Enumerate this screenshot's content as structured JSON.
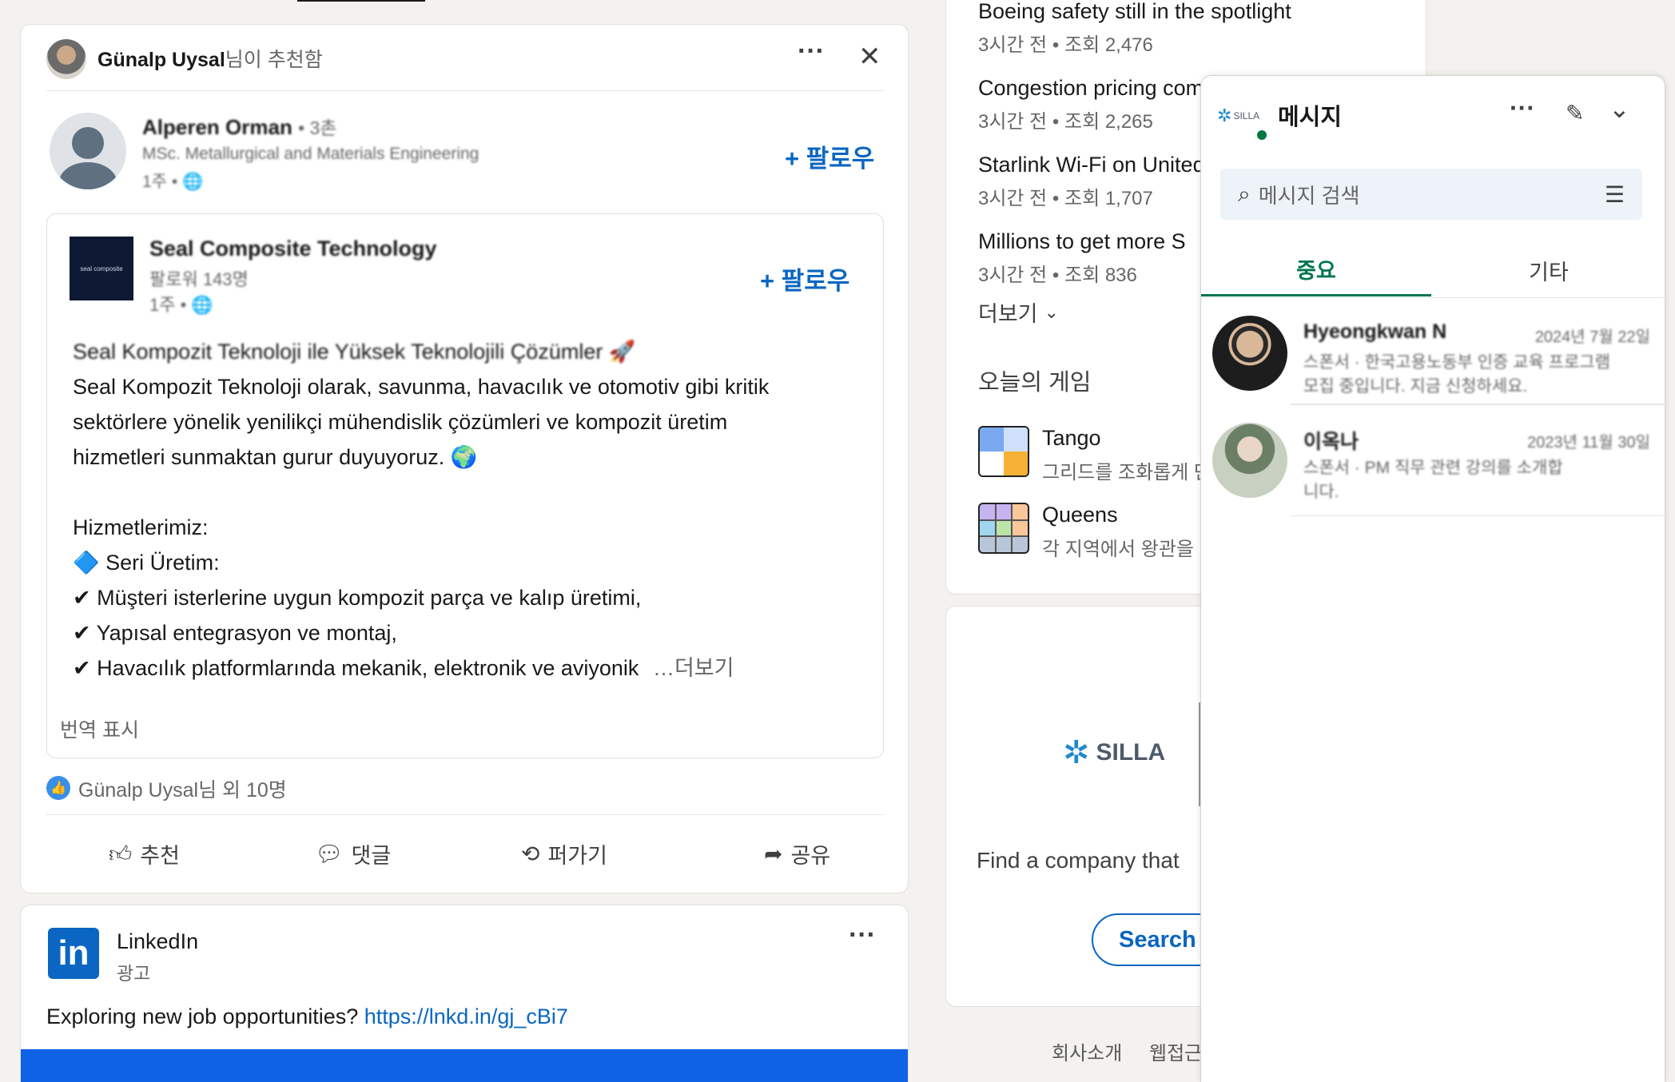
{
  "post": {
    "recommender_name": "Günalp Uysal",
    "recommender_suffix": "님이 추천함",
    "more_label": "···",
    "close_label": "✕",
    "author_name": "Alperen Orman",
    "author_degree": "• 3촌",
    "author_headline": "MSc. Metallurgical and Materials Engineering",
    "author_time": "1주 • 🌐",
    "follow_label": "+ 팔로우",
    "company_name": "Seal Composite Technology",
    "company_followers": "팔로워 143명",
    "company_time": "1주 • 🌐",
    "company_logo_text": "seal composite",
    "company_follow_label": "+ 팔로우",
    "body_lines": [
      "Seal Kompozit Teknoloji ile Yüksek Teknolojili Çözümler 🚀",
      "Seal Kompozit Teknoloji olarak, savunma, havacılık ve otomotiv gibi kritik",
      "sektörlere yönelik yenilikçi mühendislik çözümleri ve kompozit üretim",
      "hizmetleri sunmaktan gurur duyuyoruz. 🌍",
      "",
      "Hizmetlerimiz:",
      "🔷 Seri Üretim:",
      "✔ Müşteri isterlerine uygun kompozit parça ve kalıp üretimi,",
      "✔ Yapısal entegrasyon ve montaj,",
      "✔ Havacılık platformlarında mekanik, elektronik ve aviyonik"
    ],
    "see_more": "…더보기",
    "translate_label": "번역 표시",
    "reactions_text": "Günalp Uysal님 외 10명",
    "actions": {
      "like": "추천",
      "comment": "댓글",
      "repost": "퍼가기",
      "share": "공유"
    }
  },
  "ad": {
    "name": "LinkedIn",
    "sub": "광고",
    "more_label": "···",
    "text": "Exploring new job opportunities? ",
    "link": "https://lnkd.in/gj_cBi7"
  },
  "news": {
    "items": [
      {
        "title": "Boeing safety still in the spotlight",
        "meta": "3시간 전 • 조회 2,476"
      },
      {
        "title": "Congestion pricing comes to NYC",
        "meta": "3시간 전 • 조회 2,265"
      },
      {
        "title": "Starlink Wi-Fi on United",
        "meta": "3시간 전 • 조회 1,707"
      },
      {
        "title": "Millions to get more S",
        "meta": "3시간 전 • 조회 836"
      }
    ],
    "more_label": "더보기",
    "games_title": "오늘의 게임",
    "games": [
      {
        "name": "Tango",
        "desc": "그리드를 조화롭게 만"
      },
      {
        "name": "Queens",
        "desc": "각 지역에서 왕관을"
      }
    ]
  },
  "promo": {
    "logo_text": "SILLA",
    "text": "Find a company that",
    "search_label": "Search"
  },
  "footer": {
    "about": "회사소개",
    "accessibility": "웹접근"
  },
  "messaging": {
    "title": "메시지",
    "avatar_text": "SILLA",
    "search_placeholder": "메시지 검색",
    "tabs": [
      "중요",
      "기타"
    ],
    "conversations": [
      {
        "name": "Hyeongkwan N",
        "date": "2024년 7월 22일",
        "preview_line1": "스폰서 · 한국고용노동부 인증 교육 프로그램",
        "preview_line2": "모집 중입니다. 지금 신청하세요."
      },
      {
        "name": "이옥나",
        "date": "2023년 11월 30일",
        "preview_line1": "스폰서 · PM 직무 관련 강의를 소개합",
        "preview_line2": "니다."
      }
    ]
  }
}
